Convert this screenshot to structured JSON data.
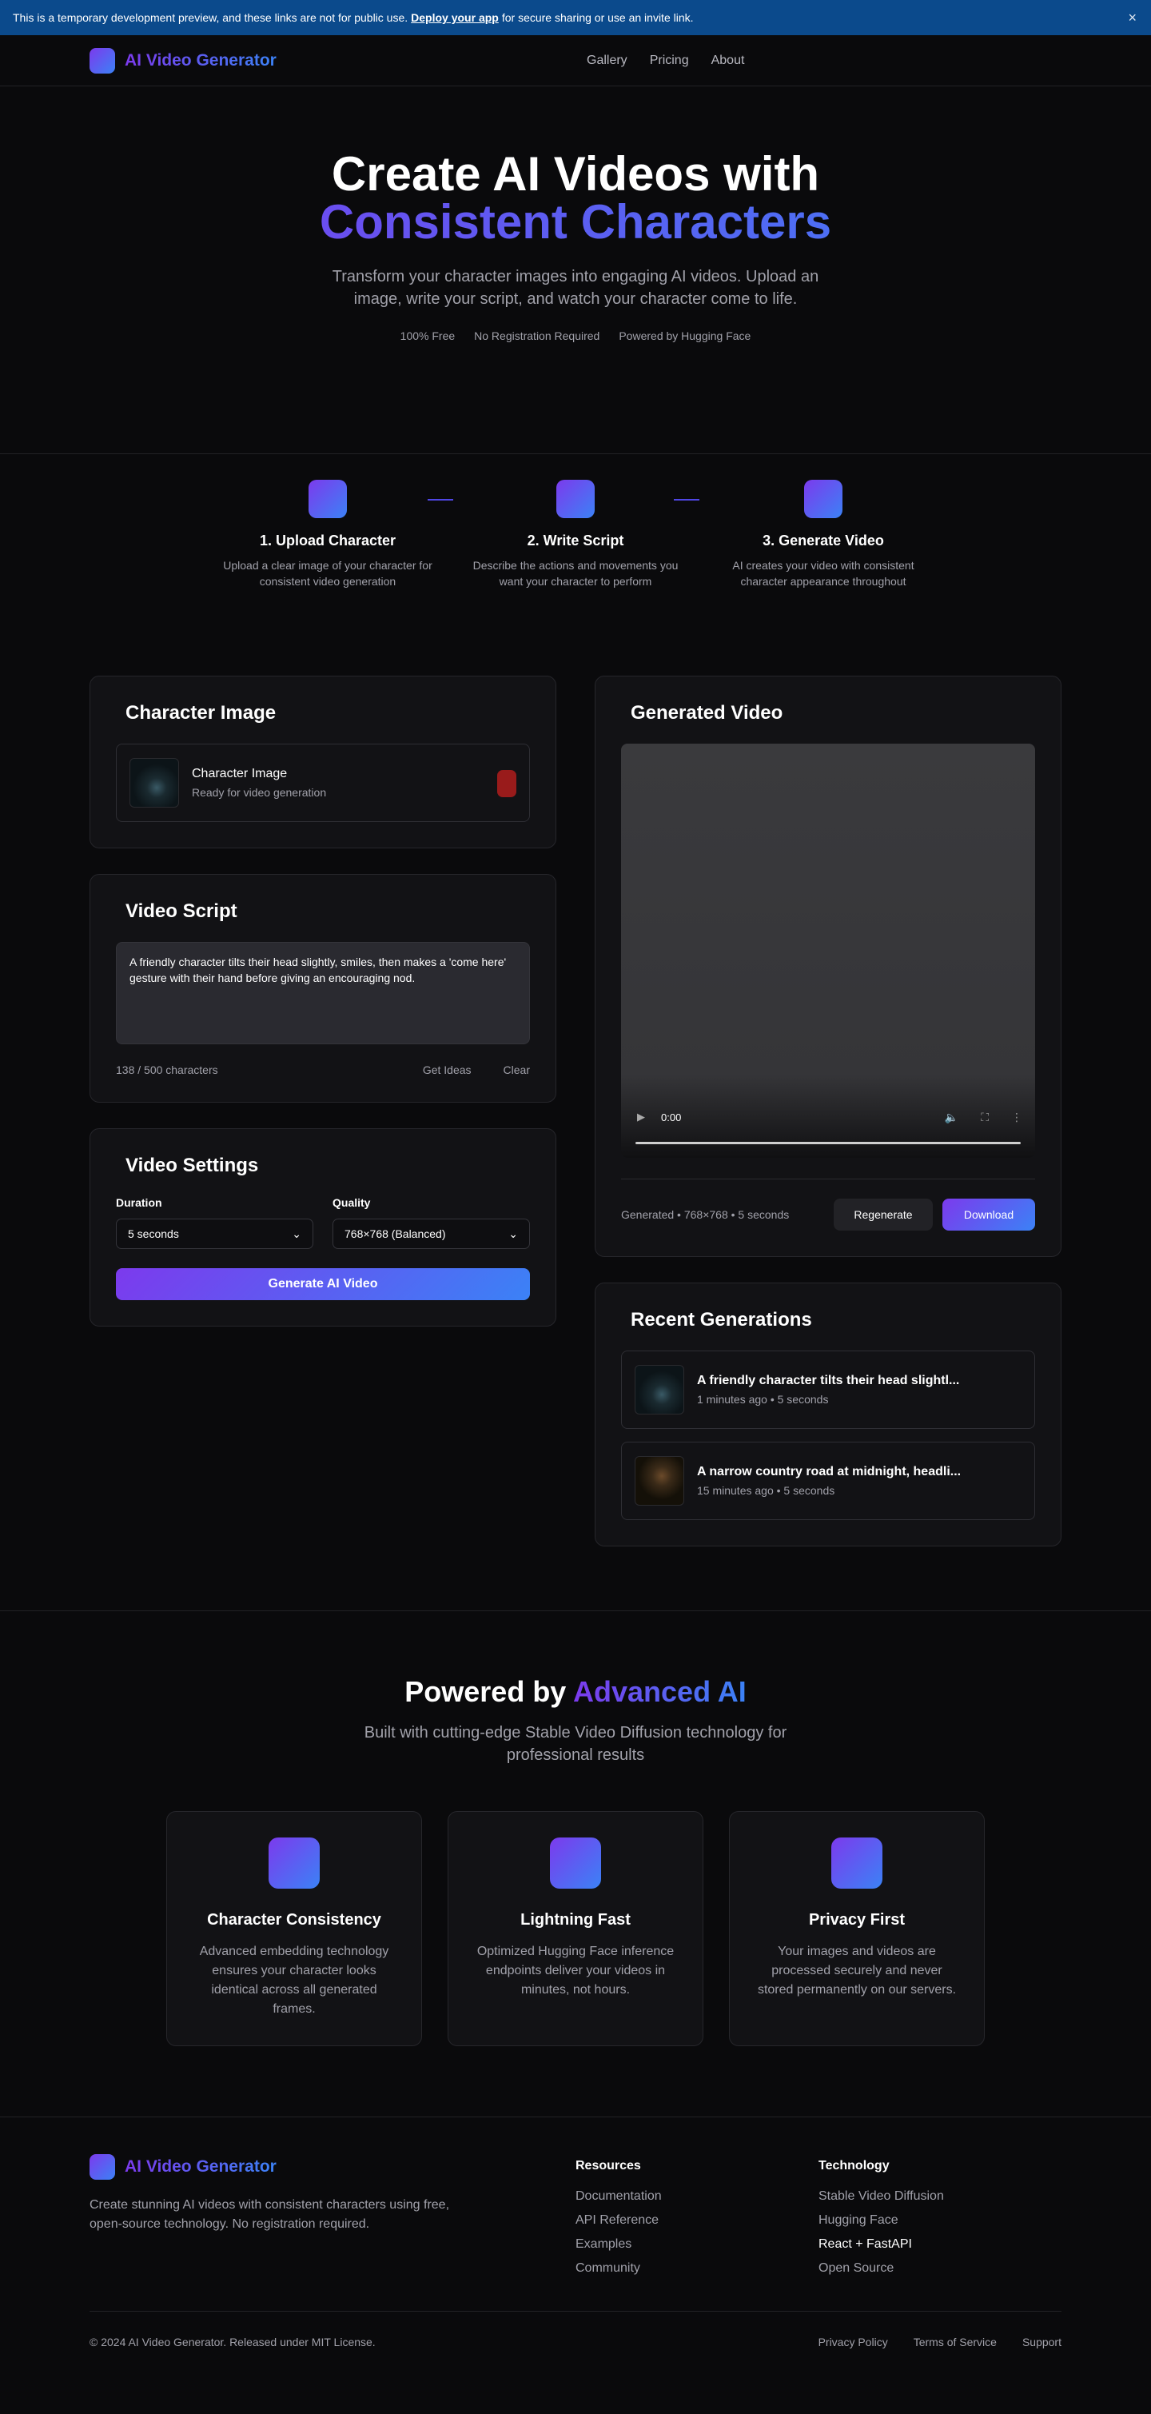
{
  "banner": {
    "text_before": "This is a temporary development preview, and these links are not for public use.",
    "link": "Deploy your app",
    "text_after": "for secure sharing or use an invite link.",
    "close": "×"
  },
  "header": {
    "brand": "AI Video Generator",
    "nav": [
      "Gallery",
      "Pricing",
      "About"
    ]
  },
  "hero": {
    "title_line1": "Create AI Videos with",
    "title_line2": "Consistent Characters",
    "subtitle": "Transform your character images into engaging AI videos. Upload an image, write your script, and watch your character come to life.",
    "badges": [
      "100% Free",
      "No Registration Required",
      "Powered by Hugging Face"
    ]
  },
  "steps": [
    {
      "title": "1. Upload Character",
      "desc": "Upload a clear image of your character for consistent video generation"
    },
    {
      "title": "2. Write Script",
      "desc": "Describe the actions and movements you want your character to perform"
    },
    {
      "title": "3. Generate Video",
      "desc": "AI creates your video with consistent character appearance throughout"
    }
  ],
  "character": {
    "heading": "Character Image",
    "file_title": "Character Image",
    "file_status": "Ready for video generation"
  },
  "script": {
    "heading": "Video Script",
    "text": "A friendly character tilts their head slightly, smiles, then makes a 'come here' gesture with their hand before giving an encouraging nod.",
    "count": "138 / 500 characters",
    "ideas": "Get Ideas",
    "clear": "Clear"
  },
  "settings": {
    "heading": "Video Settings",
    "duration_label": "Duration",
    "duration_value": "5 seconds",
    "quality_label": "Quality",
    "quality_value": "768×768 (Balanced)",
    "generate": "Generate AI Video"
  },
  "video": {
    "heading": "Generated Video",
    "time": "0:00",
    "meta": "Generated • 768×768 • 5 seconds",
    "regenerate": "Regenerate",
    "download": "Download"
  },
  "recent": {
    "heading": "Recent Generations",
    "items": [
      {
        "title": "A friendly character tilts their head slightl...",
        "meta": "1 minutes ago • 5 seconds"
      },
      {
        "title": "A narrow country road at midnight, headli...",
        "meta": "15 minutes ago • 5 seconds"
      }
    ]
  },
  "features": {
    "title_plain": "Powered by",
    "title_accent": "Advanced AI",
    "subtitle": "Built with cutting-edge Stable Video Diffusion technology for professional results",
    "items": [
      {
        "title": "Character Consistency",
        "desc": "Advanced embedding technology ensures your character looks identical across all generated frames."
      },
      {
        "title": "Lightning Fast",
        "desc": "Optimized Hugging Face inference endpoints deliver your videos in minutes, not hours."
      },
      {
        "title": "Privacy First",
        "desc": "Your images and videos are processed securely and never stored permanently on our servers."
      }
    ]
  },
  "footer": {
    "brand": "AI Video Generator",
    "tagline": "Create stunning AI videos with consistent characters using free, open-source technology. No registration required.",
    "resources": {
      "heading": "Resources",
      "links": [
        "Documentation",
        "API Reference",
        "Examples",
        "Community"
      ]
    },
    "technology": {
      "heading": "Technology",
      "links": [
        "Stable Video Diffusion",
        "Hugging Face",
        "React + FastAPI",
        "Open Source"
      ]
    },
    "copyright": "© 2024 AI Video Generator. Released under MIT License.",
    "bottom_links": [
      "Privacy Policy",
      "Terms of Service",
      "Support"
    ]
  }
}
